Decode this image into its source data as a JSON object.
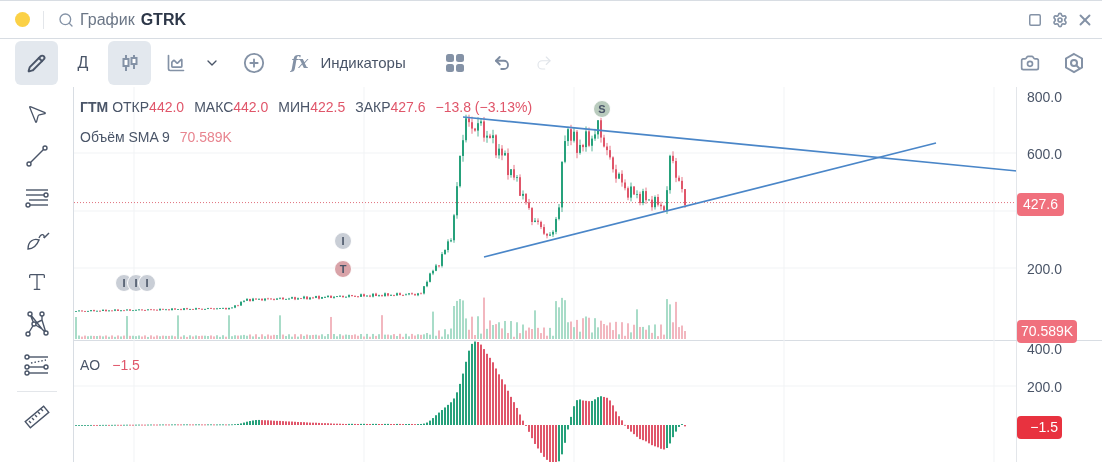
{
  "window": {
    "title": "График",
    "symbol": "GTRK"
  },
  "toolbar": [
    {
      "kind": "draw",
      "selected": true
    },
    {
      "kind": "interval",
      "label": "Д"
    },
    {
      "kind": "candles",
      "selected": true
    },
    {
      "kind": "area",
      "selected": false
    },
    {
      "kind": "chevron"
    },
    {
      "kind": "add"
    },
    {
      "kind": "indicators",
      "icon": "fx",
      "label": "Индикаторы"
    },
    {
      "kind": "layout"
    },
    {
      "kind": "undo",
      "disabled": false
    },
    {
      "kind": "redo",
      "disabled": true
    }
  ],
  "tools": [
    {
      "kind": "cursor"
    },
    {
      "kind": "trendline"
    },
    {
      "kind": "parallel"
    },
    {
      "kind": "brush"
    },
    {
      "kind": "text"
    },
    {
      "kind": "pattern"
    },
    {
      "kind": "fib"
    },
    {
      "kind": "ruler"
    }
  ],
  "legend": {
    "symbol": "ГТМ",
    "fields": [
      {
        "label": "ОТКР",
        "value": "442.0"
      },
      {
        "label": "МАКС",
        "value": "442.0"
      },
      {
        "label": "МИН",
        "value": "422.5"
      },
      {
        "label": "ЗАКР",
        "value": "427.6"
      }
    ],
    "change": "−13.8 (−3.13%)"
  },
  "volume": {
    "label": "Объём SMA 9",
    "value": "70.589K",
    "badge": "70.589K"
  },
  "price_axis": {
    "ticks": [
      "800.0",
      "600.0",
      "200.0"
    ],
    "badge": "427.6"
  },
  "events": [
    {
      "label": "I",
      "color": "#c9ced6"
    },
    {
      "label": "I",
      "color": "#c9ced6"
    },
    {
      "label": "I",
      "color": "#c9ced6"
    },
    {
      "label": "I",
      "color": "#c9ced6"
    },
    {
      "label": "T",
      "color": "#d9a3a8"
    },
    {
      "label": "S",
      "color": "#b9cbbd"
    }
  ],
  "ao": {
    "label": "AO",
    "value": "−1.5",
    "ticks": [
      "400.0",
      "200.0"
    ],
    "badge": "−1.5"
  }
}
